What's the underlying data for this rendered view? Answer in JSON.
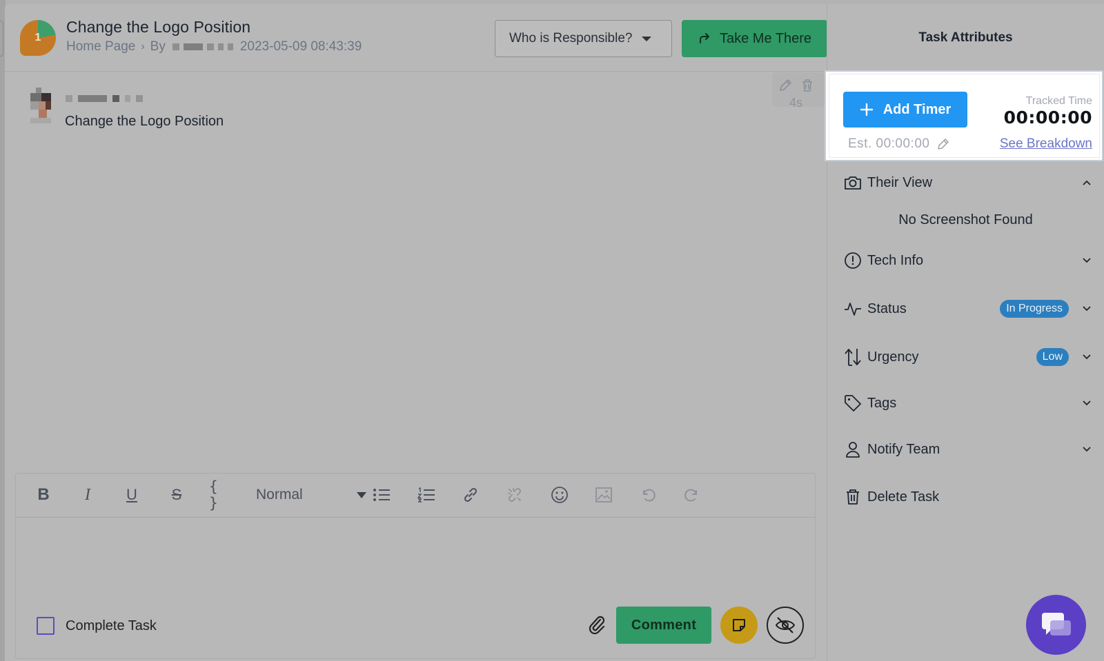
{
  "task": {
    "pin_number": "1",
    "title": "Change the Logo Position",
    "breadcrumb_page": "Home Page",
    "by_label": "By",
    "timestamp": "2023-05-09 08:43:39"
  },
  "header": {
    "responsible_label": "Who is Responsible?",
    "take_me_label": "Take Me There"
  },
  "comment": {
    "text": "Change the Logo Position",
    "ago": "4s"
  },
  "editor": {
    "format_value": "Normal",
    "bold_glyph": "B",
    "italic_glyph": "I",
    "underline_glyph": "U",
    "strike_glyph": "S",
    "code_glyph": "{ }",
    "complete_label": "Complete Task",
    "comment_button": "Comment"
  },
  "sidebar": {
    "title": "Task Attributes",
    "add_timer_label": "Add Timer",
    "tracked_label": "Tracked Time",
    "tracked_value": "00:00:00",
    "estimate": "Est. 00:00:00",
    "breakdown_link": "See Breakdown",
    "their_view": "Their View",
    "no_screenshot": "No Screenshot Found",
    "tech_info": "Tech Info",
    "status_label": "Status",
    "status_value": "In Progress",
    "urgency_label": "Urgency",
    "urgency_value": "Low",
    "tags_label": "Tags",
    "notify_label": "Notify Team",
    "delete_label": "Delete Task"
  },
  "colors": {
    "primary_green": "#2f9a66",
    "timer_blue": "#2196f3",
    "badge_blue": "#2b7fbf",
    "chat_purple": "#5b3fc4",
    "note_yellow": "#c59a16"
  }
}
